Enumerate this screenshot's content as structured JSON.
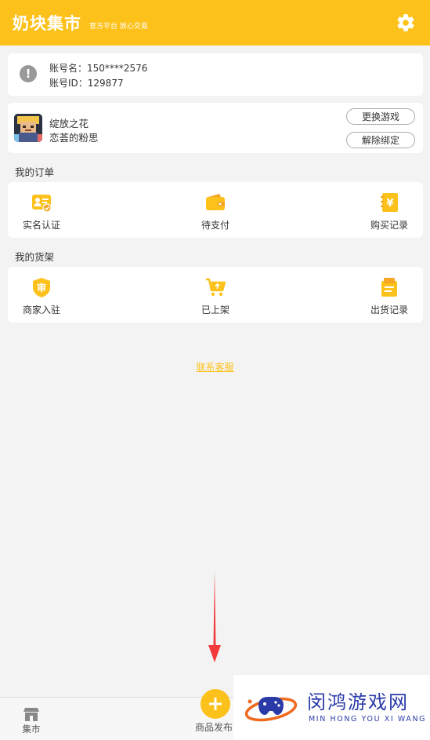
{
  "header": {
    "title": "奶块集市",
    "subtitle": "官方平台 放心交易",
    "settings_icon": "gear-icon"
  },
  "account": {
    "name_label": "账号名：150****2576",
    "id_label": "账号ID：129877"
  },
  "game": {
    "name": "绽放之花",
    "fan_name": "恋荟的粉思",
    "change_button": "更换游戏",
    "unbind_button": "解除绑定"
  },
  "orders": {
    "title": "我的订单",
    "items": [
      {
        "label": "实名认证",
        "icon": "id-card-icon"
      },
      {
        "label": "待支付",
        "icon": "wallet-icon"
      },
      {
        "label": "购买记录",
        "icon": "yen-book-icon"
      }
    ]
  },
  "shelf": {
    "title": "我的货架",
    "items": [
      {
        "label": "商家入驻",
        "icon": "shield-badge-icon"
      },
      {
        "label": "已上架",
        "icon": "cart-upload-icon"
      },
      {
        "label": "出货记录",
        "icon": "box-icon"
      }
    ]
  },
  "contact_link": "联系客服",
  "tabbar": {
    "market_label": "集市",
    "publish_label": "商品发布"
  },
  "watermark": {
    "title": "闵鸿游戏网",
    "subtitle": "MIN HONG YOU XI WANG"
  },
  "colors": {
    "accent": "#fcc21b",
    "background": "#f3f3f3",
    "arrow": "#f23a3a",
    "watermark": "#2a3ba8"
  }
}
